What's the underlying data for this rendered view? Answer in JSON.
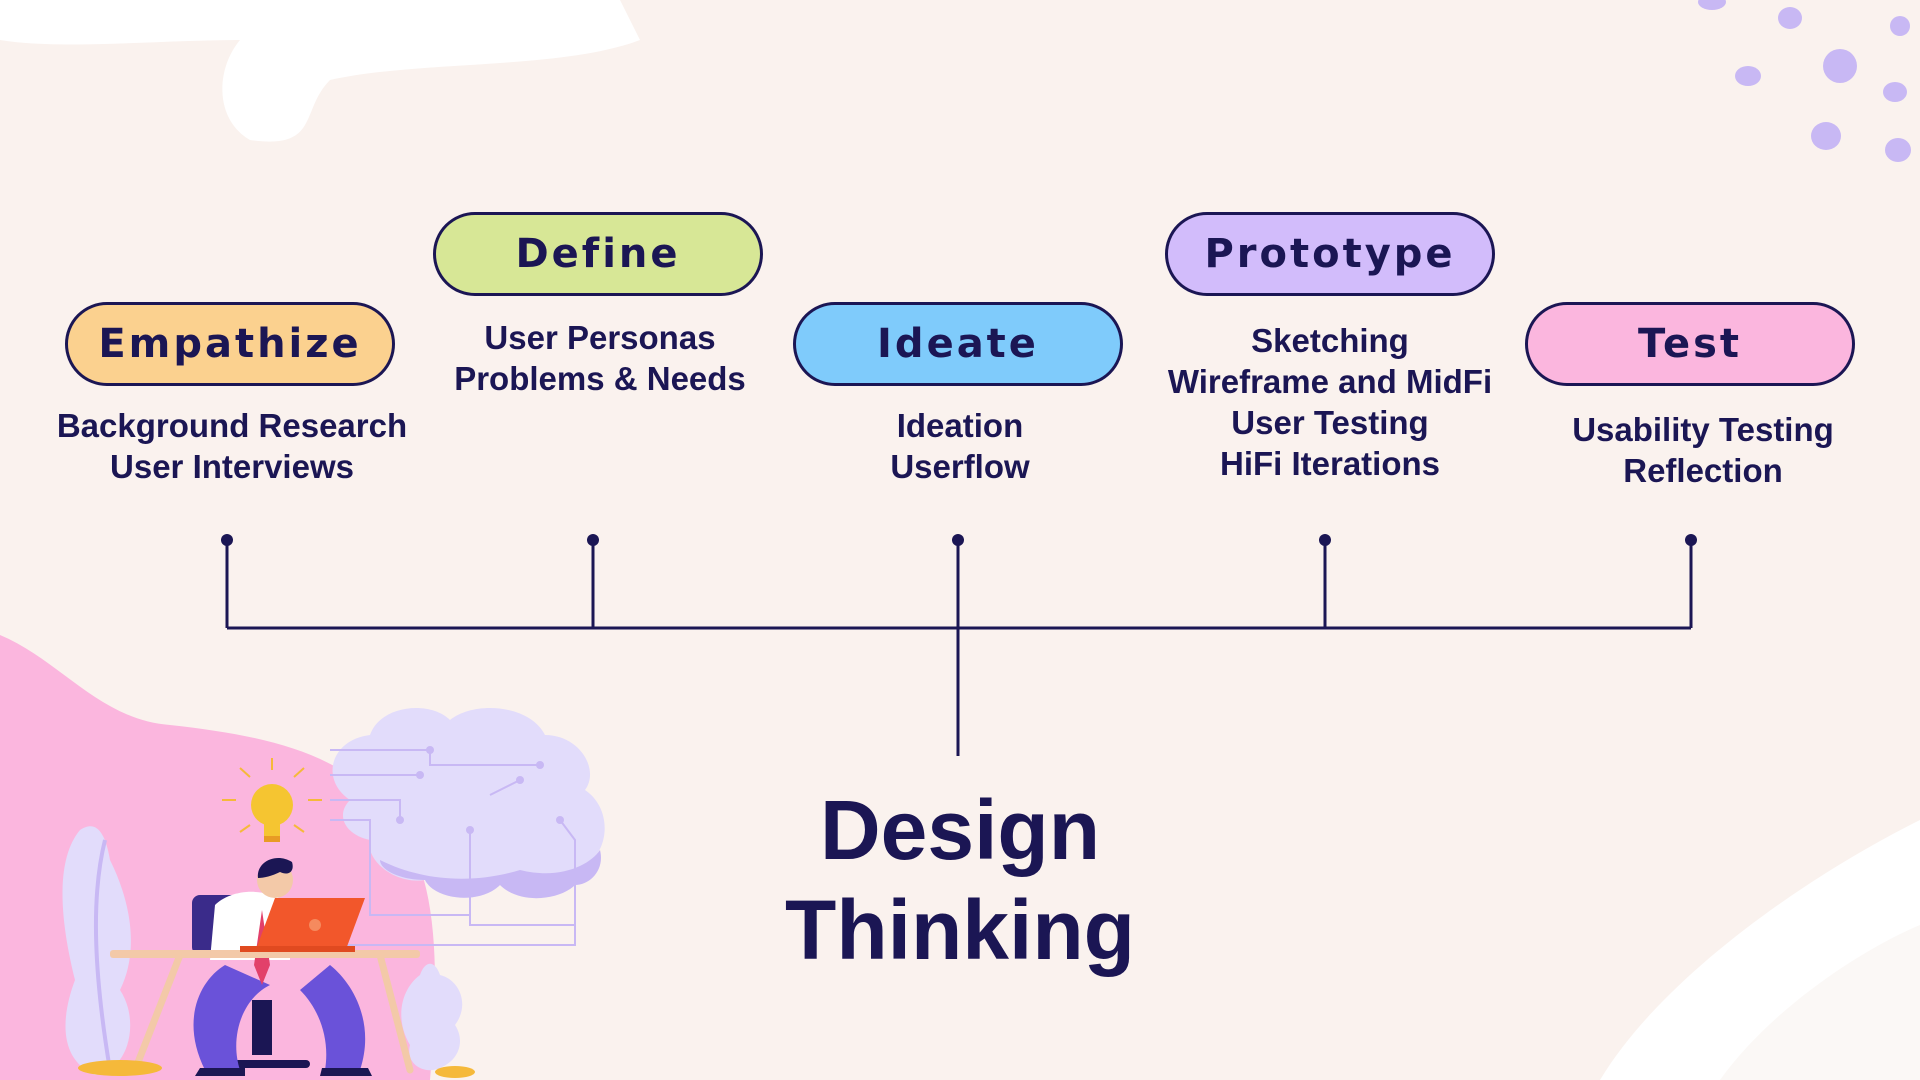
{
  "colors": {
    "background": "#faf2ee",
    "ink": "#1b1654",
    "empathize": "#fbd18f",
    "define": "#d7e796",
    "ideate": "#7fcbfb",
    "prototype": "#d2bcfb",
    "test": "#fbb6de",
    "pink_blob": "#fbb6de",
    "lavender": "#c8b8f4"
  },
  "title": {
    "line1": "Design",
    "line2": "Thinking"
  },
  "stages": [
    {
      "label": "Empathize",
      "lines": [
        "Background Research",
        "User Interviews"
      ]
    },
    {
      "label": "Define",
      "lines": [
        "User Personas",
        "Problems & Needs"
      ]
    },
    {
      "label": "Ideate",
      "lines": [
        "Ideation",
        "Userflow"
      ]
    },
    {
      "label": "Prototype",
      "lines": [
        "Sketching",
        "Wireframe and MidFi",
        "User Testing",
        "HiFi Iterations"
      ]
    },
    {
      "label": "Test",
      "lines": [
        "Usability Testing",
        "Reflection"
      ]
    }
  ],
  "illustration": {
    "icons": [
      "lightbulb-icon",
      "cloud-icon",
      "laptop-icon",
      "person-icon",
      "plant-icon"
    ]
  }
}
